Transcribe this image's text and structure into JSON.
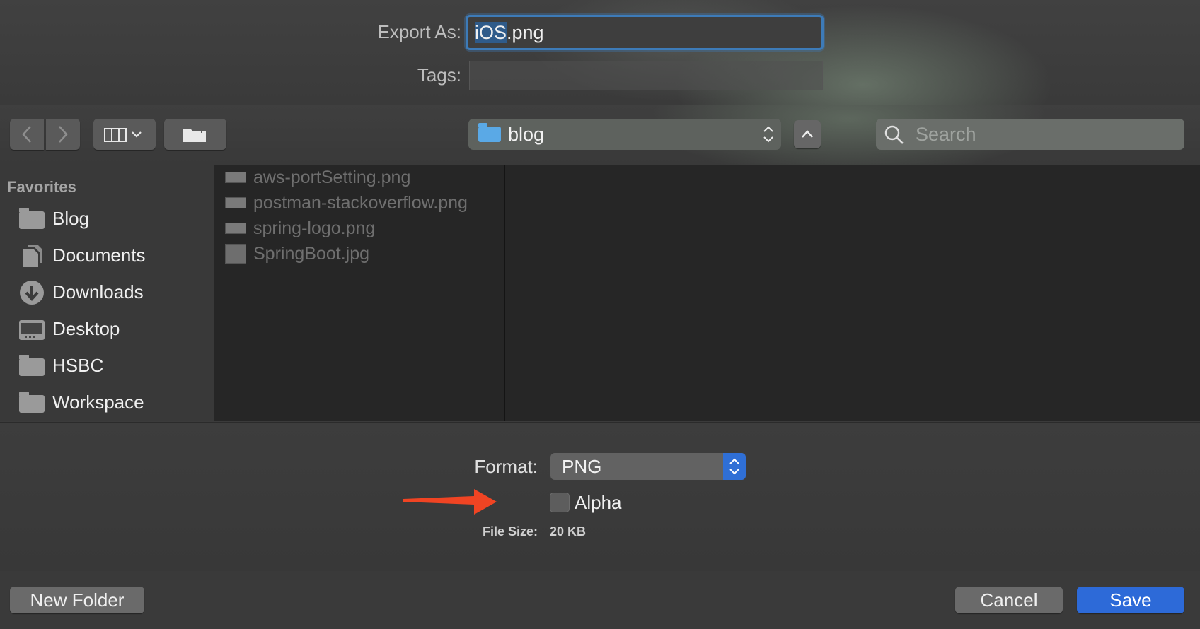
{
  "header": {
    "export_label": "Export As:",
    "filename_selected": "iOS",
    "filename_ext": ".png",
    "tags_label": "Tags:",
    "tags_value": ""
  },
  "toolbar": {
    "location": "blog",
    "search_placeholder": "Search"
  },
  "sidebar": {
    "section_title": "Favorites",
    "items": [
      {
        "label": "Blog",
        "icon": "folder-icon"
      },
      {
        "label": "Documents",
        "icon": "documents-icon"
      },
      {
        "label": "Downloads",
        "icon": "downloads-icon"
      },
      {
        "label": "Desktop",
        "icon": "desktop-icon"
      },
      {
        "label": "HSBC",
        "icon": "folder-icon"
      },
      {
        "label": "Workspace",
        "icon": "folder-icon"
      }
    ]
  },
  "files": [
    {
      "name": "aws-portSetting.png"
    },
    {
      "name": "postman-stackoverflow.png"
    },
    {
      "name": "spring-logo.png"
    },
    {
      "name": "SpringBoot.jpg"
    }
  ],
  "options": {
    "format_label": "Format:",
    "format_value": "PNG",
    "alpha_label": "Alpha",
    "alpha_checked": false,
    "filesize_label": "File Size:",
    "filesize_value": "20 KB"
  },
  "footer": {
    "new_folder": "New Folder",
    "cancel": "Cancel",
    "save": "Save"
  },
  "colors": {
    "accent": "#2d6ad8",
    "focus_ring": "#3d7bb8",
    "annotation_arrow": "#f04423"
  }
}
